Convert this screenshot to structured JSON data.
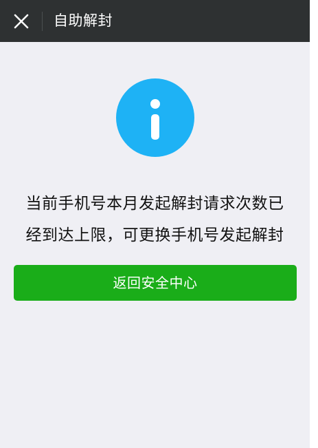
{
  "header": {
    "title": "自助解封"
  },
  "message": {
    "line1": "当前手机号本月发起解封请求次数已",
    "line2": "经到达上限，可更换手机号发起解封"
  },
  "actions": {
    "back_label": "返回安全中心"
  },
  "icons": {
    "close": "close-icon",
    "info": "info-icon"
  },
  "colors": {
    "header_bg": "#2e3132",
    "page_bg": "#efeff4",
    "info_blue": "#1eb2f5",
    "button_green": "#1aad19"
  }
}
